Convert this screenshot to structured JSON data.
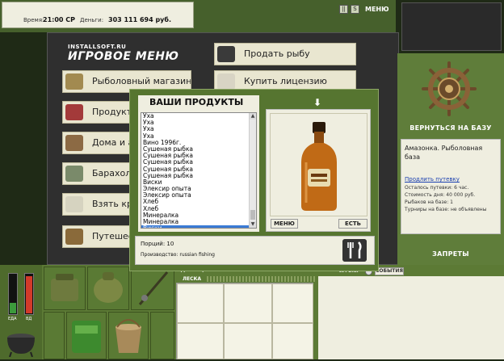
{
  "status": {
    "time_label": "Время:",
    "time_value": "21:00 СР",
    "money_label": "Деньги:",
    "money_value": "303 111 694 руб."
  },
  "top_icons": {
    "icon1": "||",
    "icon2": "S",
    "menu_label": "МЕНЮ"
  },
  "menu": {
    "logo_small": "INSTALLSOFT.RU",
    "logo_big": "ИГРОВОЕ МЕНЮ",
    "left_items": [
      {
        "label": "Рыболовный магазин",
        "icon": "spider-icon"
      },
      {
        "label": "Продукты",
        "icon": "berries-icon"
      },
      {
        "label": "Дома и а",
        "icon": "house-icon"
      },
      {
        "label": "Барахол",
        "icon": "money-icon"
      },
      {
        "label": "Взять кр",
        "icon": "piggy-bank-icon"
      },
      {
        "label": "Путешес",
        "icon": "helm-icon"
      }
    ],
    "right_items": [
      {
        "label": "Продать рыбу",
        "icon": "fish-icon"
      },
      {
        "label": "Купить лицензию",
        "icon": "license-icon"
      }
    ]
  },
  "dialog": {
    "title": "ВАШИ ПРОДУКТЫ",
    "products": [
      "Уха",
      "Уха",
      "Уха",
      "Уха",
      "Вино 1996г.",
      "Сушеная рыбка",
      "Сушеная рыбка",
      "Сушеная рыбка",
      "Сушеная рыбка",
      "Сушеная рыбка",
      "Виски",
      "Элексир опыта",
      "Элексир опыта",
      "Хлеб",
      "Хлеб",
      "Минералка",
      "Минералка",
      "Виски"
    ],
    "selected_index": 17,
    "menu_button": "МЕНЮ",
    "eat_button": "ЕСТЬ",
    "portions": "Порций: 10",
    "producer": "Производство: russian fishing"
  },
  "base": {
    "return_label": "ВЕРНУТЬСЯ НА БАЗУ",
    "name": "Амазонка. Рыболовная база",
    "extend_link": "Продлить путевку",
    "lines": [
      "Осталось путевки: 6 час.",
      "Стоимость дня: 40 000 руб.",
      "Рыбаков на базе: 1",
      "Турниры на базе: не объявлены"
    ],
    "bans_label": "ЗАПРЕТЫ"
  },
  "bottom": {
    "gauge1_label": "ЕДА",
    "gauge2_label": "ВД",
    "gauge1_level": 0.28,
    "gauge2_level": 0.95,
    "equip_label_1": "УДИЛИЩЕ",
    "equip_label_2": "ЛЕСКА",
    "player_label": "ИГРОКИ",
    "events_label": "СОБЫТИЯ"
  },
  "colors": {
    "accent_green": "#567530",
    "panel_bg": "#efeee0",
    "selection_blue": "#3a7bd5",
    "gauge_green": "#3c9a3c",
    "gauge_red": "#d23a2a"
  }
}
